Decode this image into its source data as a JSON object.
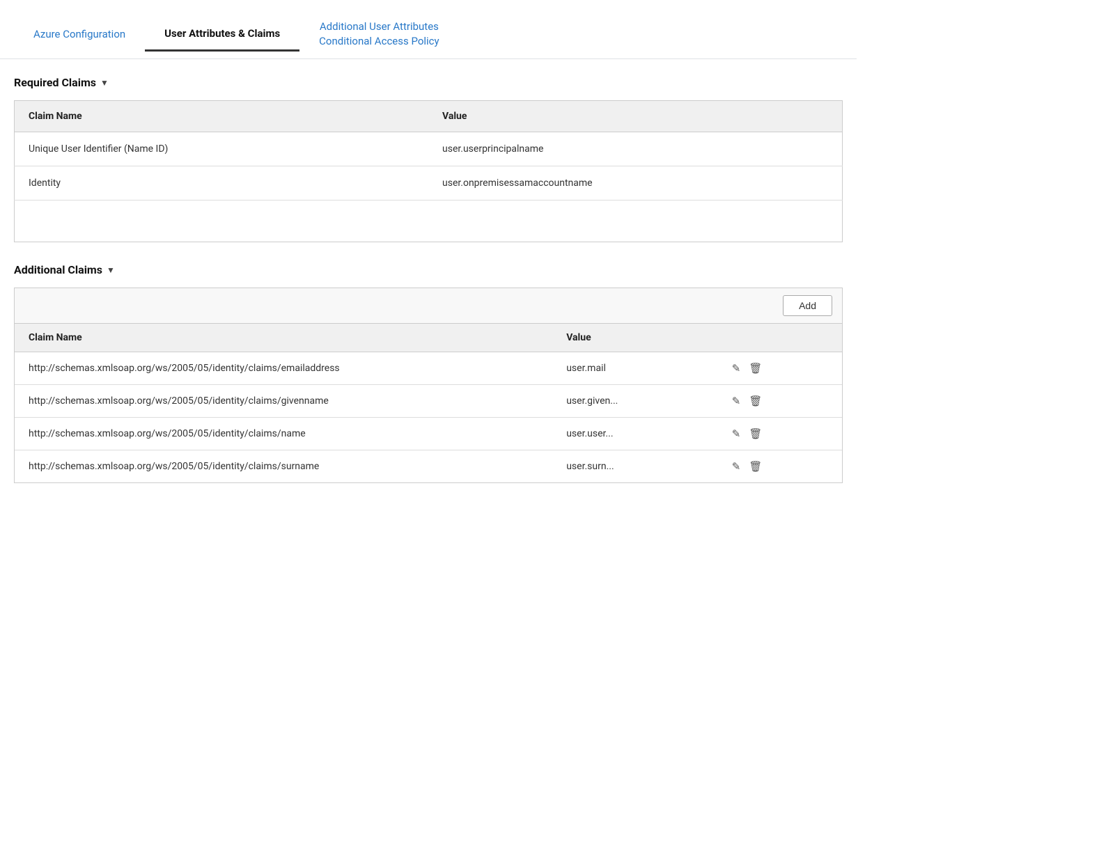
{
  "nav": {
    "tab_azure": "Azure Configuration",
    "tab_user_attrs": "User Attributes & Claims",
    "tab_additional_user": "Additional User Attributes",
    "tab_conditional": "Conditional Access Policy"
  },
  "required_claims": {
    "section_label": "Required Claims",
    "chevron": "▼",
    "col_name": "Claim Name",
    "col_value": "Value",
    "rows": [
      {
        "name": "Unique User Identifier (Name ID)",
        "value": "user.userprincipalname"
      },
      {
        "name": "Identity",
        "value": "user.onpremisessamaccountname"
      }
    ]
  },
  "additional_claims": {
    "section_label": "Additional Claims",
    "chevron": "▼",
    "add_label": "Add",
    "col_name": "Claim Name",
    "col_value": "Value",
    "rows": [
      {
        "name": "http://schemas.xmlsoap.org/ws/2005/05/identity/claims/emailaddress",
        "value": "user.mail"
      },
      {
        "name": "http://schemas.xmlsoap.org/ws/2005/05/identity/claims/givenname",
        "value": "user.given..."
      },
      {
        "name": "http://schemas.xmlsoap.org/ws/2005/05/identity/claims/name",
        "value": "user.user..."
      },
      {
        "name": "http://schemas.xmlsoap.org/ws/2005/05/identity/claims/surname",
        "value": "user.surn..."
      }
    ]
  },
  "icons": {
    "edit": "✎",
    "delete": "🗑"
  }
}
